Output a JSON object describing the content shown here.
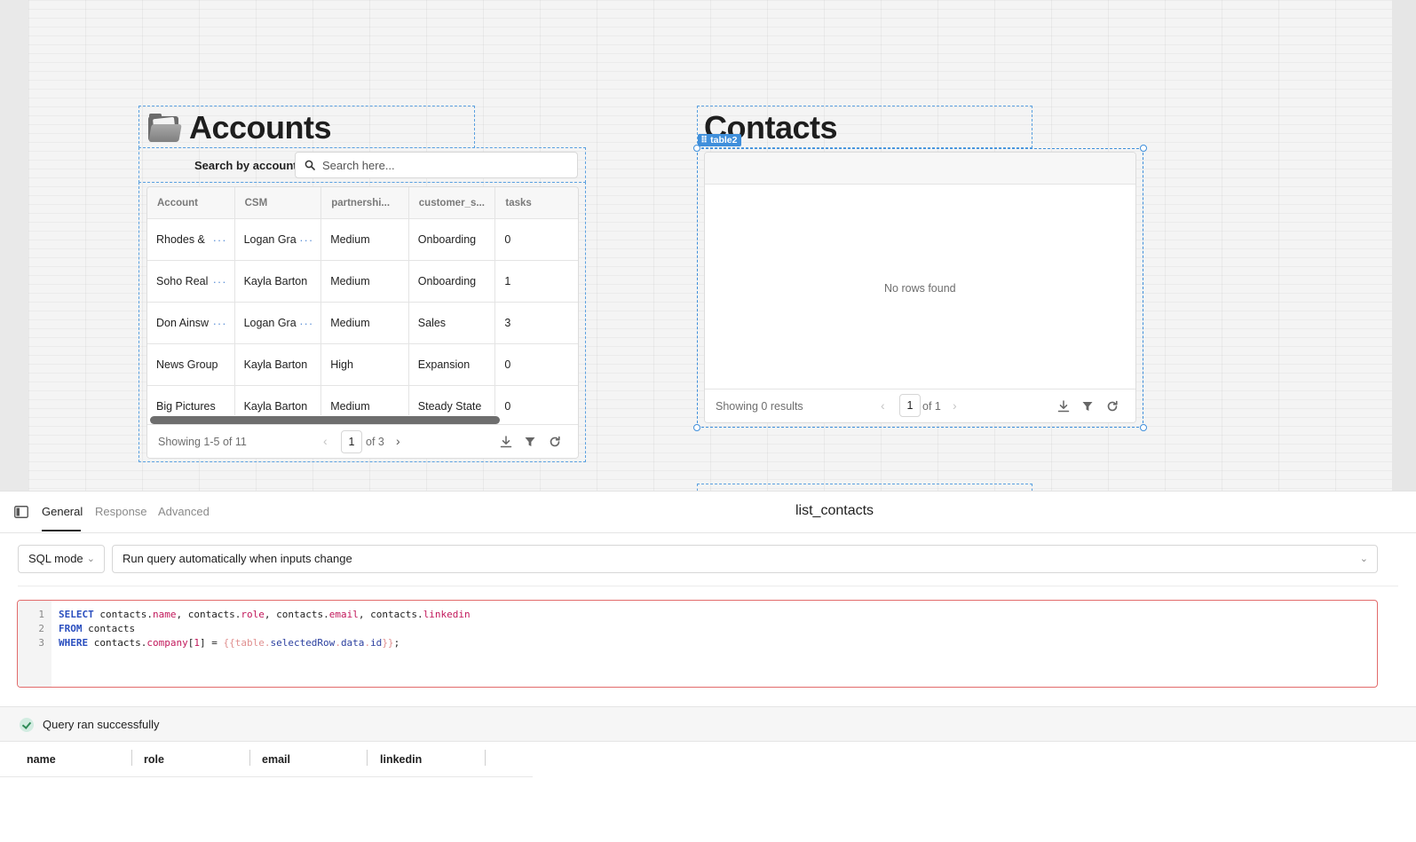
{
  "accounts": {
    "title": "Accounts",
    "search_label": "Search by account",
    "search_placeholder": "Search here...",
    "columns": [
      "Account",
      "CSM",
      "partnershi...",
      "customer_s...",
      "tasks"
    ],
    "rows": [
      {
        "account": "Rhodes &",
        "csm": "Logan Gra",
        "partnership": "Medium",
        "stage": "Onboarding",
        "tasks": "0"
      },
      {
        "account": "Soho Real",
        "csm": "Kayla Barton",
        "partnership": "Medium",
        "stage": "Onboarding",
        "tasks": "1"
      },
      {
        "account": "Don Ainsw",
        "csm": "Logan Gra",
        "partnership": "Medium",
        "stage": "Sales",
        "tasks": "3"
      },
      {
        "account": "News Group",
        "csm": "Kayla Barton",
        "partnership": "High",
        "stage": "Expansion",
        "tasks": "0"
      },
      {
        "account": "Big Pictures",
        "csm": "Kayla Barton",
        "partnership": "Medium",
        "stage": "Steady State",
        "tasks": "0"
      }
    ],
    "footer_text": "Showing 1-5 of 11",
    "page": "1",
    "page_of": "of 3"
  },
  "contacts": {
    "title": "Contacts",
    "widget_tag": "table2",
    "empty_text": "No rows found",
    "footer_text": "Showing 0 results",
    "page": "1",
    "page_of": "of 1"
  },
  "panel": {
    "tabs": [
      "General",
      "Response",
      "Advanced"
    ],
    "active_tab": "General",
    "query_name": "list_contacts",
    "mode": "SQL mode",
    "trigger": "Run query automatically when inputs change",
    "code_lines": [
      "1",
      "2",
      "3"
    ],
    "status": "Query ran successfully",
    "result_columns": [
      "name",
      "role",
      "email",
      "linkedin"
    ]
  },
  "icons": {
    "sidebar_toggle": "sidebar-toggle-icon",
    "search": "search-icon",
    "download": "download-icon",
    "filter": "filter-icon",
    "refresh": "refresh-icon",
    "check": "check-circle-icon"
  },
  "colors": {
    "selection": "#3f8fdb",
    "error_border": "#e26b6b",
    "keyword": "#2b4fbf",
    "property": "#c2185b",
    "success": "#2e8b57"
  }
}
